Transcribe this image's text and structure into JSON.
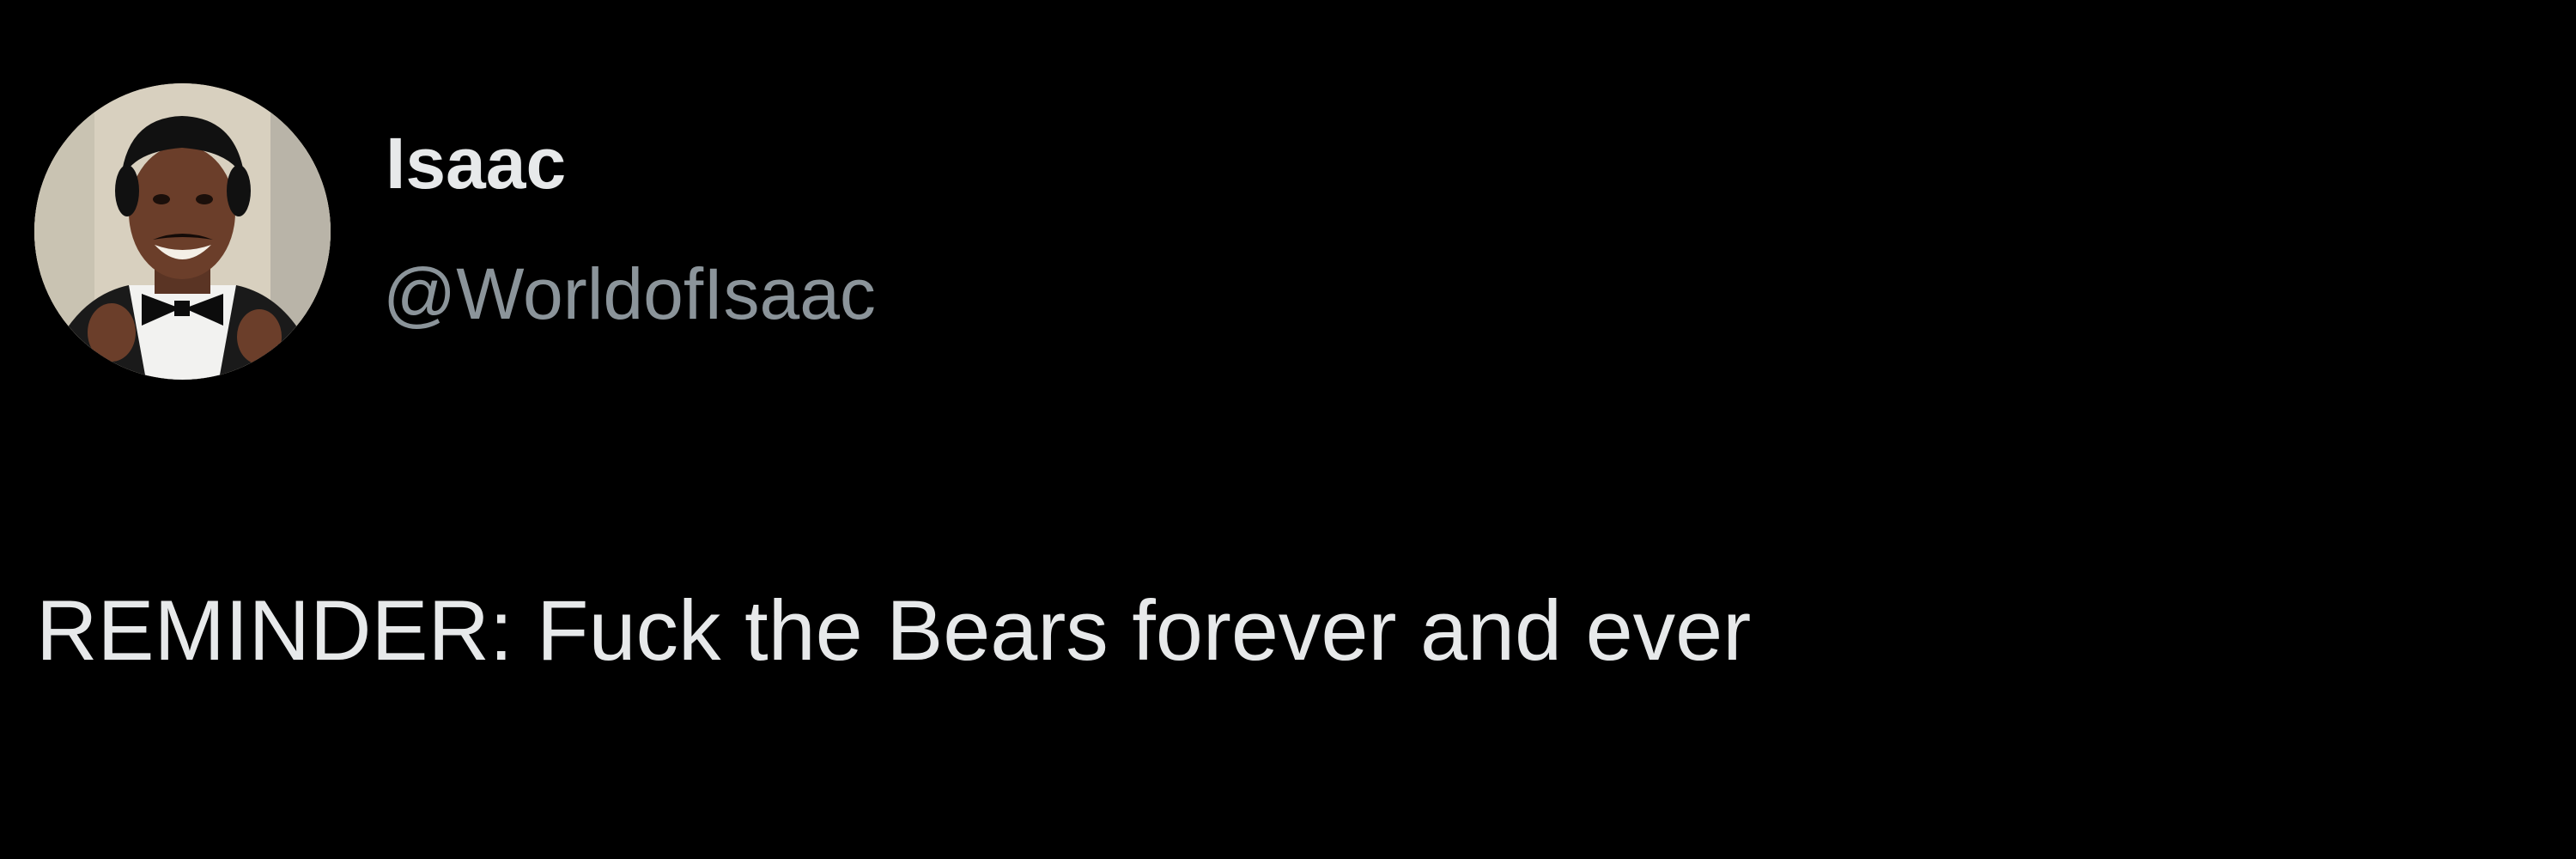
{
  "tweet": {
    "author": {
      "display_name": "Isaac",
      "handle": "@WorldofIsaac",
      "avatar_icon": "profile-photo"
    },
    "text": "REMINDER: Fuck the Bears forever and ever"
  },
  "colors": {
    "background": "#000000",
    "primary_text": "#e7e9ea",
    "secondary_text": "#8b949a"
  }
}
